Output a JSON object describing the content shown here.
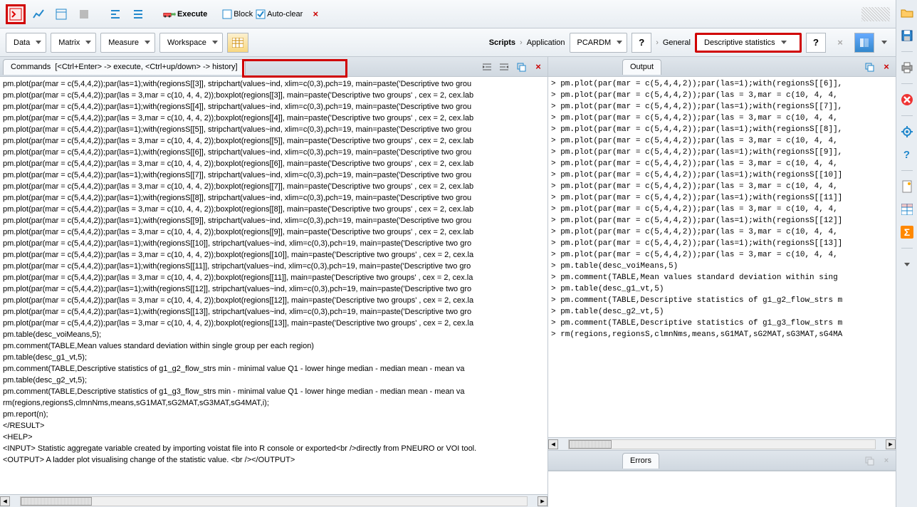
{
  "toolbar": {
    "execute_label": "Execute",
    "block_label": "Block",
    "autoclear_label": "Auto-clear"
  },
  "dropdowns": {
    "data": "Data",
    "matrix": "Matrix",
    "measure": "Measure",
    "workspace": "Workspace"
  },
  "breadcrumb": {
    "scripts": "Scripts",
    "application": "Application",
    "app_value": "PCARDM",
    "general": "General",
    "stat_value": "Descriptive statistics"
  },
  "commands_tab": {
    "label": "Commands",
    "hint": "[<Ctrl+Enter> -> execute, <Ctrl+up/down> -> history]"
  },
  "output_tab": "Output",
  "errors_tab": "Errors",
  "commands_code": [
    "pm.plot(par(mar = c(5,4,4,2));par(las=1);with(regionsS[[3]], stripchart(values~ind, xlim=c(0,3),pch=19, main=paste('Descriptive two grou",
    "pm.plot(par(mar = c(5,4,4,2));par(las = 3,mar = c(10, 4, 4, 2));boxplot(regions[[3]], main=paste('Descriptive two groups' , cex = 2, cex.lab",
    "pm.plot(par(mar = c(5,4,4,2));par(las=1);with(regionsS[[4]], stripchart(values~ind, xlim=c(0,3),pch=19, main=paste('Descriptive two grou",
    "pm.plot(par(mar = c(5,4,4,2));par(las = 3,mar = c(10, 4, 4, 2));boxplot(regions[[4]], main=paste('Descriptive two groups' , cex = 2, cex.lab",
    "pm.plot(par(mar = c(5,4,4,2));par(las=1);with(regionsS[[5]], stripchart(values~ind, xlim=c(0,3),pch=19, main=paste('Descriptive two grou",
    "pm.plot(par(mar = c(5,4,4,2));par(las = 3,mar = c(10, 4, 4, 2));boxplot(regions[[5]], main=paste('Descriptive two groups' , cex = 2, cex.lab",
    "pm.plot(par(mar = c(5,4,4,2));par(las=1);with(regionsS[[6]], stripchart(values~ind, xlim=c(0,3),pch=19, main=paste('Descriptive two grou",
    "pm.plot(par(mar = c(5,4,4,2));par(las = 3,mar = c(10, 4, 4, 2));boxplot(regions[[6]], main=paste('Descriptive two groups' , cex = 2, cex.lab",
    "pm.plot(par(mar = c(5,4,4,2));par(las=1);with(regionsS[[7]], stripchart(values~ind, xlim=c(0,3),pch=19, main=paste('Descriptive two grou",
    "pm.plot(par(mar = c(5,4,4,2));par(las = 3,mar = c(10, 4, 4, 2));boxplot(regions[[7]], main=paste('Descriptive two groups' , cex = 2, cex.lab",
    "pm.plot(par(mar = c(5,4,4,2));par(las=1);with(regionsS[[8]], stripchart(values~ind, xlim=c(0,3),pch=19, main=paste('Descriptive two grou",
    "pm.plot(par(mar = c(5,4,4,2));par(las = 3,mar = c(10, 4, 4, 2));boxplot(regions[[8]], main=paste('Descriptive two groups' , cex = 2, cex.lab",
    "pm.plot(par(mar = c(5,4,4,2));par(las=1);with(regionsS[[9]], stripchart(values~ind, xlim=c(0,3),pch=19, main=paste('Descriptive two grou",
    "pm.plot(par(mar = c(5,4,4,2));par(las = 3,mar = c(10, 4, 4, 2));boxplot(regions[[9]], main=paste('Descriptive two groups' , cex = 2, cex.lab",
    "pm.plot(par(mar = c(5,4,4,2));par(las=1);with(regionsS[[10]], stripchart(values~ind, xlim=c(0,3),pch=19, main=paste('Descriptive two gro",
    "pm.plot(par(mar = c(5,4,4,2));par(las = 3,mar = c(10, 4, 4, 2));boxplot(regions[[10]], main=paste('Descriptive two groups' , cex = 2, cex.la",
    "pm.plot(par(mar = c(5,4,4,2));par(las=1);with(regionsS[[11]], stripchart(values~ind, xlim=c(0,3),pch=19, main=paste('Descriptive two gro",
    "pm.plot(par(mar = c(5,4,4,2));par(las = 3,mar = c(10, 4, 4, 2));boxplot(regions[[11]], main=paste('Descriptive two groups' , cex = 2, cex.la",
    "pm.plot(par(mar = c(5,4,4,2));par(las=1);with(regionsS[[12]], stripchart(values~ind, xlim=c(0,3),pch=19, main=paste('Descriptive two gro",
    "pm.plot(par(mar = c(5,4,4,2));par(las = 3,mar = c(10, 4, 4, 2));boxplot(regions[[12]], main=paste('Descriptive two groups' , cex = 2, cex.la",
    "pm.plot(par(mar = c(5,4,4,2));par(las=1);with(regionsS[[13]], stripchart(values~ind, xlim=c(0,3),pch=19, main=paste('Descriptive two gro",
    "pm.plot(par(mar = c(5,4,4,2));par(las = 3,mar = c(10, 4, 4, 2));boxplot(regions[[13]], main=paste('Descriptive two groups' , cex = 2, cex.la",
    "pm.table(desc_voiMeans,5);",
    "pm.comment(TABLE,Mean values standard deviation within single group per each region)",
    "pm.table(desc_g1_vt,5);",
    "pm.comment(TABLE,Descriptive statistics of g1_g2_flow_strs min - minimal value Q1 - lower hinge median - median mean - mean va",
    "pm.table(desc_g2_vt,5);",
    "pm.comment(TABLE,Descriptive statistics of g1_g3_flow_strs min - minimal value Q1 - lower hinge median - median mean - mean va",
    "rm(regions,regionsS,clmnNms,means,sG1MAT,sG2MAT,sG3MAT,sG4MAT,i);",
    "pm.report(n);",
    "</RESULT>",
    "<HELP>",
    "<INPUT> Statistic aggregate variable created by importing voistat file into R console or exported<br />directly from PNEURO or VOI tool.",
    "<OUTPUT> A ladder plot visualising change of the statistic value. <br /></OUTPUT>"
  ],
  "output_code": [
    "> pm.plot(par(mar = c(5,4,4,2));par(las=1);with(regionsS[[6]],",
    "> pm.plot(par(mar = c(5,4,4,2));par(las = 3,mar = c(10, 4, 4,",
    "> pm.plot(par(mar = c(5,4,4,2));par(las=1);with(regionsS[[7]],",
    "> pm.plot(par(mar = c(5,4,4,2));par(las = 3,mar = c(10, 4, 4,",
    "> pm.plot(par(mar = c(5,4,4,2));par(las=1);with(regionsS[[8]],",
    "> pm.plot(par(mar = c(5,4,4,2));par(las = 3,mar = c(10, 4, 4,",
    "> pm.plot(par(mar = c(5,4,4,2));par(las=1);with(regionsS[[9]],",
    "> pm.plot(par(mar = c(5,4,4,2));par(las = 3,mar = c(10, 4, 4,",
    "> pm.plot(par(mar = c(5,4,4,2));par(las=1);with(regionsS[[10]]",
    "> pm.plot(par(mar = c(5,4,4,2));par(las = 3,mar = c(10, 4, 4,",
    "> pm.plot(par(mar = c(5,4,4,2));par(las=1);with(regionsS[[11]]",
    "> pm.plot(par(mar = c(5,4,4,2));par(las = 3,mar = c(10, 4, 4,",
    "> pm.plot(par(mar = c(5,4,4,2));par(las=1);with(regionsS[[12]]",
    "> pm.plot(par(mar = c(5,4,4,2));par(las = 3,mar = c(10, 4, 4,",
    "> pm.plot(par(mar = c(5,4,4,2));par(las=1);with(regionsS[[13]]",
    "> pm.plot(par(mar = c(5,4,4,2));par(las = 3,mar = c(10, 4, 4,",
    "> pm.table(desc_voiMeans,5)",
    "> pm.comment(TABLE,Mean values standard deviation within sing",
    "> pm.table(desc_g1_vt,5)",
    "> pm.comment(TABLE,Descriptive statistics of g1_g2_flow_strs m",
    "> pm.table(desc_g2_vt,5)",
    "> pm.comment(TABLE,Descriptive statistics of g1_g3_flow_strs m",
    "> rm(regions,regionsS,clmnNms,means,sG1MAT,sG2MAT,sG3MAT,sG4MA"
  ],
  "qmark": "?"
}
